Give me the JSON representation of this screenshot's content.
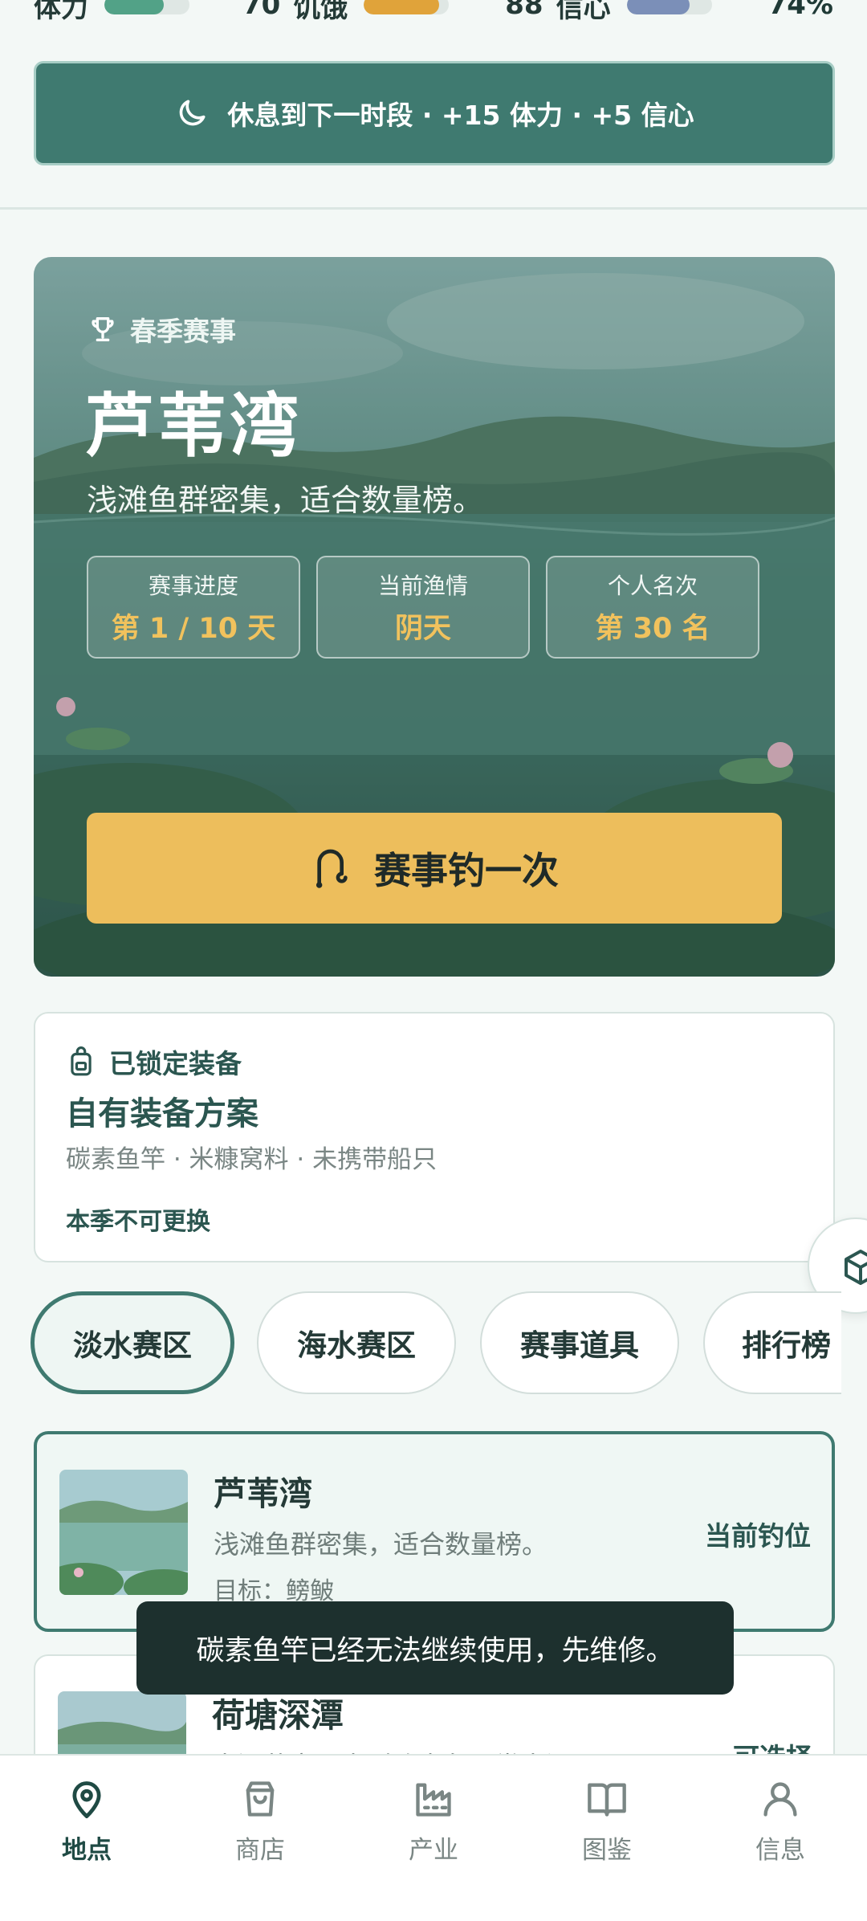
{
  "colors": {
    "primary": "#3f7a70",
    "accent": "#edbe5c",
    "stamina_bar": "#52a287",
    "hunger_bar": "#e0a33a",
    "confidence_bar": "#7b8fb8"
  },
  "status": {
    "stamina_label": "体力",
    "stamina_value": "70",
    "stamina_fill": 0.7,
    "hunger_label": "饥饿",
    "hunger_value": "88",
    "hunger_fill": 0.88,
    "confidence_label": "信心",
    "confidence_value": "74%",
    "confidence_fill": 0.74
  },
  "rest_button": {
    "icon": "moon-icon",
    "label": "休息到下一时段 · +15 体力 · +5 信心"
  },
  "hero": {
    "tag": "春季赛事",
    "tag_icon": "trophy-icon",
    "title": "芦苇湾",
    "description": "浅滩鱼群密集，适合数量榜。",
    "stats": [
      {
        "label": "赛事进度",
        "value": "第 1 / 10 天"
      },
      {
        "label": "当前渔情",
        "value": "阴天"
      },
      {
        "label": "个人名次",
        "value": "第 30 名"
      }
    ],
    "cast_button": {
      "icon": "fishing-rod-icon",
      "label": "赛事钓一次"
    }
  },
  "gear": {
    "header": "已锁定装备",
    "header_icon": "backpack-icon",
    "title": "自有装备方案",
    "items": "碳素鱼竿 · 米糠窝料 · 未携带船只",
    "note": "本季不可更换"
  },
  "tabs": [
    {
      "label": "淡水赛区",
      "active": true
    },
    {
      "label": "海水赛区",
      "active": false
    },
    {
      "label": "赛事道具",
      "active": false
    },
    {
      "label": "排行榜",
      "active": false
    }
  ],
  "spots": [
    {
      "name": "芦苇湾",
      "description": "浅滩鱼群密集，适合数量榜。",
      "target": "目标：鳑鲏",
      "status": "当前钓位",
      "current": true
    },
    {
      "name": "荷塘深潭",
      "description": "水深草密，大型淡水鱼更常出没。",
      "target": "",
      "status": "可选择",
      "current": false
    }
  ],
  "toast": "碳素鱼竿已经无法继续使用，先维修。",
  "nav": [
    {
      "label": "地点",
      "icon": "map-pin-icon",
      "active": true
    },
    {
      "label": "商店",
      "icon": "shopping-bag-icon",
      "active": false
    },
    {
      "label": "产业",
      "icon": "factory-icon",
      "active": false
    },
    {
      "label": "图鉴",
      "icon": "book-icon",
      "active": false
    },
    {
      "label": "信息",
      "icon": "user-icon",
      "active": false
    }
  ]
}
